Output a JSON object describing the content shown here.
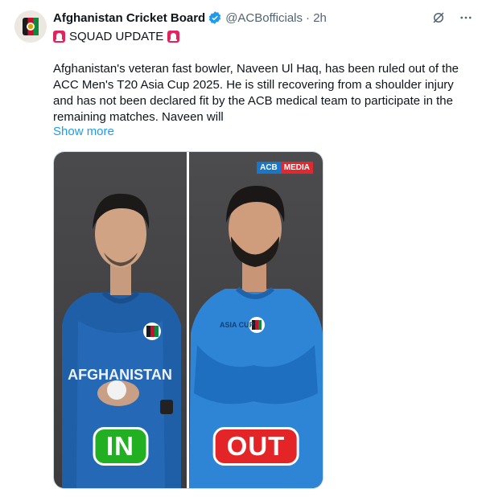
{
  "account": {
    "name": "Afghanistan Cricket Board",
    "handle": "@ACBofficials",
    "time": "· 2h"
  },
  "tweet": {
    "tag": "SQUAD UPDATE",
    "text": "Afghanistan's veteran fast bowler, Naveen Ul Haq, has been ruled out of the ACC Men's T20 Asia Cup 2025. He is still recovering from a shoulder injury and has not been declared fit by the ACB medical team to participate in the remaining matches. Naveen will",
    "show_more": "Show more"
  },
  "media": {
    "logo_left": "ACB",
    "logo_right": "MEDIA",
    "jersey_text": "AFGHANISTAN",
    "jersey_right": "ASIA CUP",
    "in_label": "IN",
    "out_label": "OUT"
  },
  "colors": {
    "link": "#1d9bf0",
    "verified": "#1d9bf0",
    "in": "#22b022",
    "out": "#e32527"
  },
  "icons": [
    "grok-icon",
    "more-icon",
    "verified-icon",
    "siren-icon"
  ]
}
